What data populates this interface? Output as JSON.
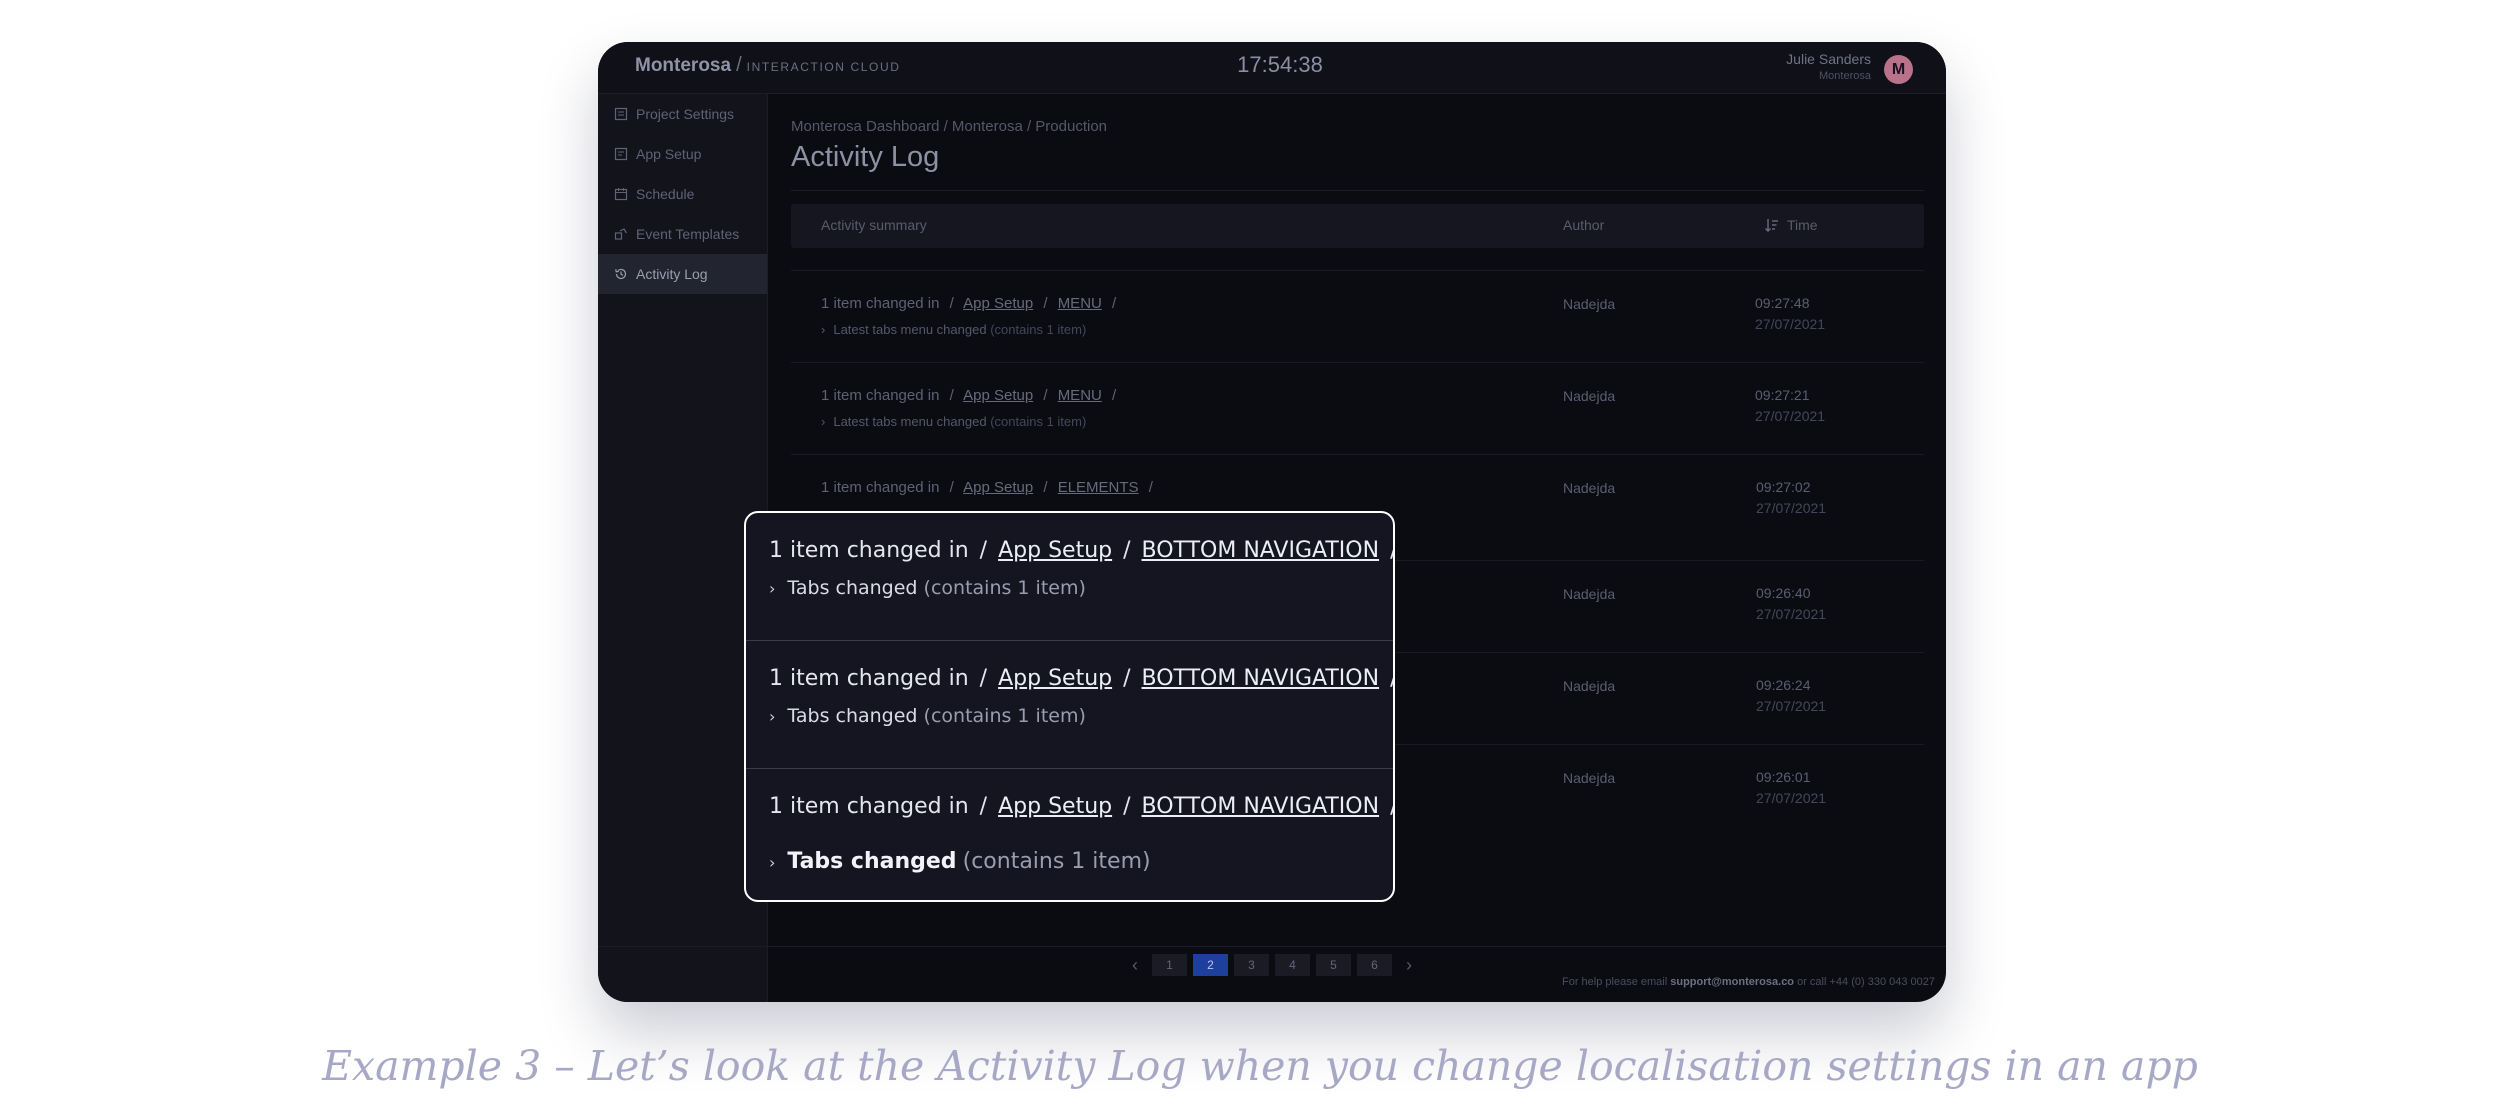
{
  "topbar": {
    "logo_main": "Monterosa",
    "logo_sep": "/",
    "logo_sub": "INTERACTION CLOUD",
    "clock": "17:54:38",
    "user_name": "Julie Sanders",
    "user_org": "Monterosa",
    "avatar_letter": "M"
  },
  "sidebar": {
    "items": [
      {
        "label": "Project Settings",
        "icon": "settings-doc-icon"
      },
      {
        "label": "App Setup",
        "icon": "app-doc-icon"
      },
      {
        "label": "Schedule",
        "icon": "calendar-icon"
      },
      {
        "label": "Event Templates",
        "icon": "templates-icon"
      },
      {
        "label": "Activity Log",
        "icon": "history-icon"
      }
    ],
    "active": "Activity Log"
  },
  "main": {
    "breadcrumb": "Monterosa Dashboard / Monterosa / Production",
    "title": "Activity Log",
    "columns": {
      "summary": "Activity summary",
      "author": "Author",
      "time": "Time"
    },
    "rows": [
      {
        "prefix": "1 item changed in",
        "section": "App Setup",
        "module": "MENU",
        "detail": "Latest tabs menu changed",
        "count": "(contains 1 item)",
        "author": "Nadejda",
        "time": "09:27:48",
        "date": "27/07/2021"
      },
      {
        "prefix": "1 item changed in",
        "section": "App Setup",
        "module": "MENU",
        "detail": "Latest tabs menu changed",
        "count": "(contains 1 item)",
        "author": "Nadejda",
        "time": "09:27:21",
        "date": "27/07/2021"
      },
      {
        "prefix": "1 item changed in",
        "section": "App Setup",
        "module": "ELEMENTS",
        "detail": "",
        "count": "",
        "author": "Nadejda",
        "time": "09:27:02",
        "date": "27/07/2021"
      },
      {
        "prefix": "",
        "section": "",
        "module": "",
        "detail": "",
        "count": "",
        "author": "Nadejda",
        "time": "09:26:40",
        "date": "27/07/2021"
      },
      {
        "prefix": "",
        "section": "",
        "module": "",
        "detail": "",
        "count": "",
        "author": "Nadejda",
        "time": "09:26:24",
        "date": "27/07/2021"
      },
      {
        "prefix": "",
        "section": "",
        "module": "",
        "detail": "",
        "count": "",
        "author": "Nadejda",
        "time": "09:26:01",
        "date": "27/07/2021"
      }
    ],
    "separator": "/"
  },
  "pagination": {
    "pages": [
      "1",
      "2",
      "3",
      "4",
      "5",
      "6"
    ],
    "active": "2",
    "prev": "‹",
    "next": "›"
  },
  "footer": {
    "prefix": "For help please email",
    "email": "support@monterosa.co",
    "suffix": "or call +44 (0) 330 043 0027"
  },
  "zoom": {
    "rows": [
      {
        "prefix": "1 item changed in",
        "section": "App Setup",
        "module": "BOTTOM NAVIGATION",
        "detail": "Tabs changed",
        "count": "(contains 1 item)"
      },
      {
        "prefix": "1 item changed in",
        "section": "App Setup",
        "module": "BOTTOM NAVIGATION",
        "detail": "Tabs changed",
        "count": "(contains 1 item)"
      },
      {
        "prefix": "1 item changed in",
        "section": "App Setup",
        "module": "BOTTOM NAVIGATION",
        "detail": "Tabs changed",
        "count": "(contains 1 item)"
      }
    ],
    "separator": "/"
  },
  "caption": "Example 3 – Let’s look at the Activity Log when you change localisation settings in an app"
}
